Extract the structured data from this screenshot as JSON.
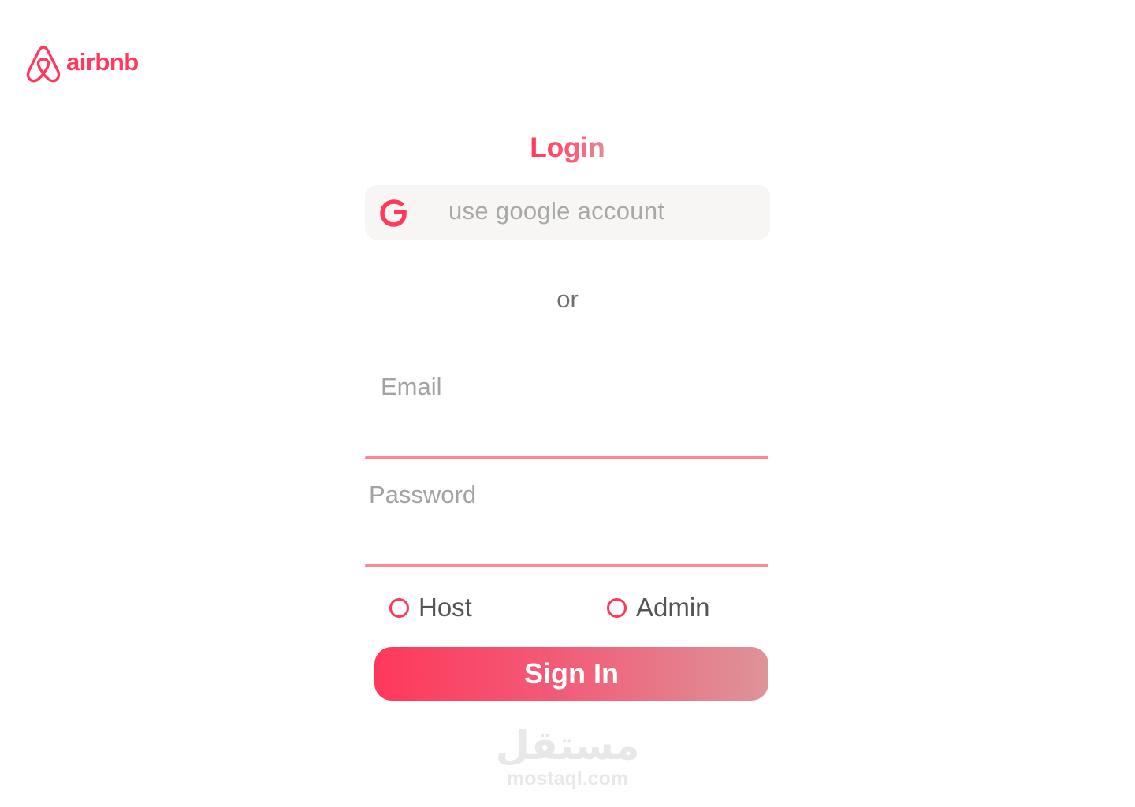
{
  "brand": {
    "name": "airbnb",
    "color": "#ff385c"
  },
  "login": {
    "title": "Login",
    "google_button": {
      "label": "use google account",
      "icon": "google-icon"
    },
    "divider_text": "or",
    "email": {
      "placeholder": "Email",
      "value": ""
    },
    "password": {
      "placeholder": "Password",
      "value": ""
    },
    "roles": [
      {
        "label": "Host",
        "selected": false
      },
      {
        "label": "Admin",
        "selected": false
      }
    ],
    "submit_label": "Sign In"
  },
  "watermark": {
    "arabic": "مستقل",
    "latin": "mostaql.com"
  },
  "colors": {
    "accent": "#ff385c",
    "accent_light": "#ff8597",
    "gradient_end": "#dd9499",
    "placeholder": "#a3a3a3",
    "google_bg": "#f7f6f5"
  }
}
